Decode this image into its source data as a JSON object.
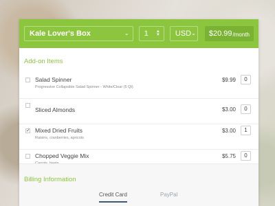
{
  "header": {
    "box_select": "Kale Lover's Box",
    "quantity": "1",
    "currency": "USD",
    "price": "$20.99",
    "price_period": "/month"
  },
  "addons": {
    "title": "Add-on Items",
    "items": [
      {
        "name": "Salad Spinner",
        "desc": "Progressive Collapsible Salad Spinner - White/Clear (5 Qt)",
        "price": "$9.99",
        "qty": "0",
        "checked": false
      },
      {
        "name": "Sliced Almonds",
        "desc": "",
        "price": "$3.00",
        "qty": "0",
        "checked": false
      },
      {
        "name": "Mixed Dried Fruits",
        "desc": "Raisins, cranberries, apricots",
        "price": "$3.00",
        "qty": "1",
        "checked": true
      },
      {
        "name": "Chopped Veggie Mix",
        "desc": "Carrots, beets",
        "price": "$5.75",
        "qty": "0",
        "checked": false
      }
    ]
  },
  "billing": {
    "title": "Billing Information",
    "tabs": [
      {
        "label": "Credit Card",
        "active": true
      },
      {
        "label": "PayPal",
        "active": false
      }
    ]
  },
  "icons": {
    "chevron": "chevron-down-icon",
    "stepper": "up-down-arrows-icon",
    "check": "checkmark-icon"
  },
  "colors": {
    "accent": "#8cc63f",
    "accent_dark": "#7ab334",
    "tab_active": "#3d5a73"
  }
}
